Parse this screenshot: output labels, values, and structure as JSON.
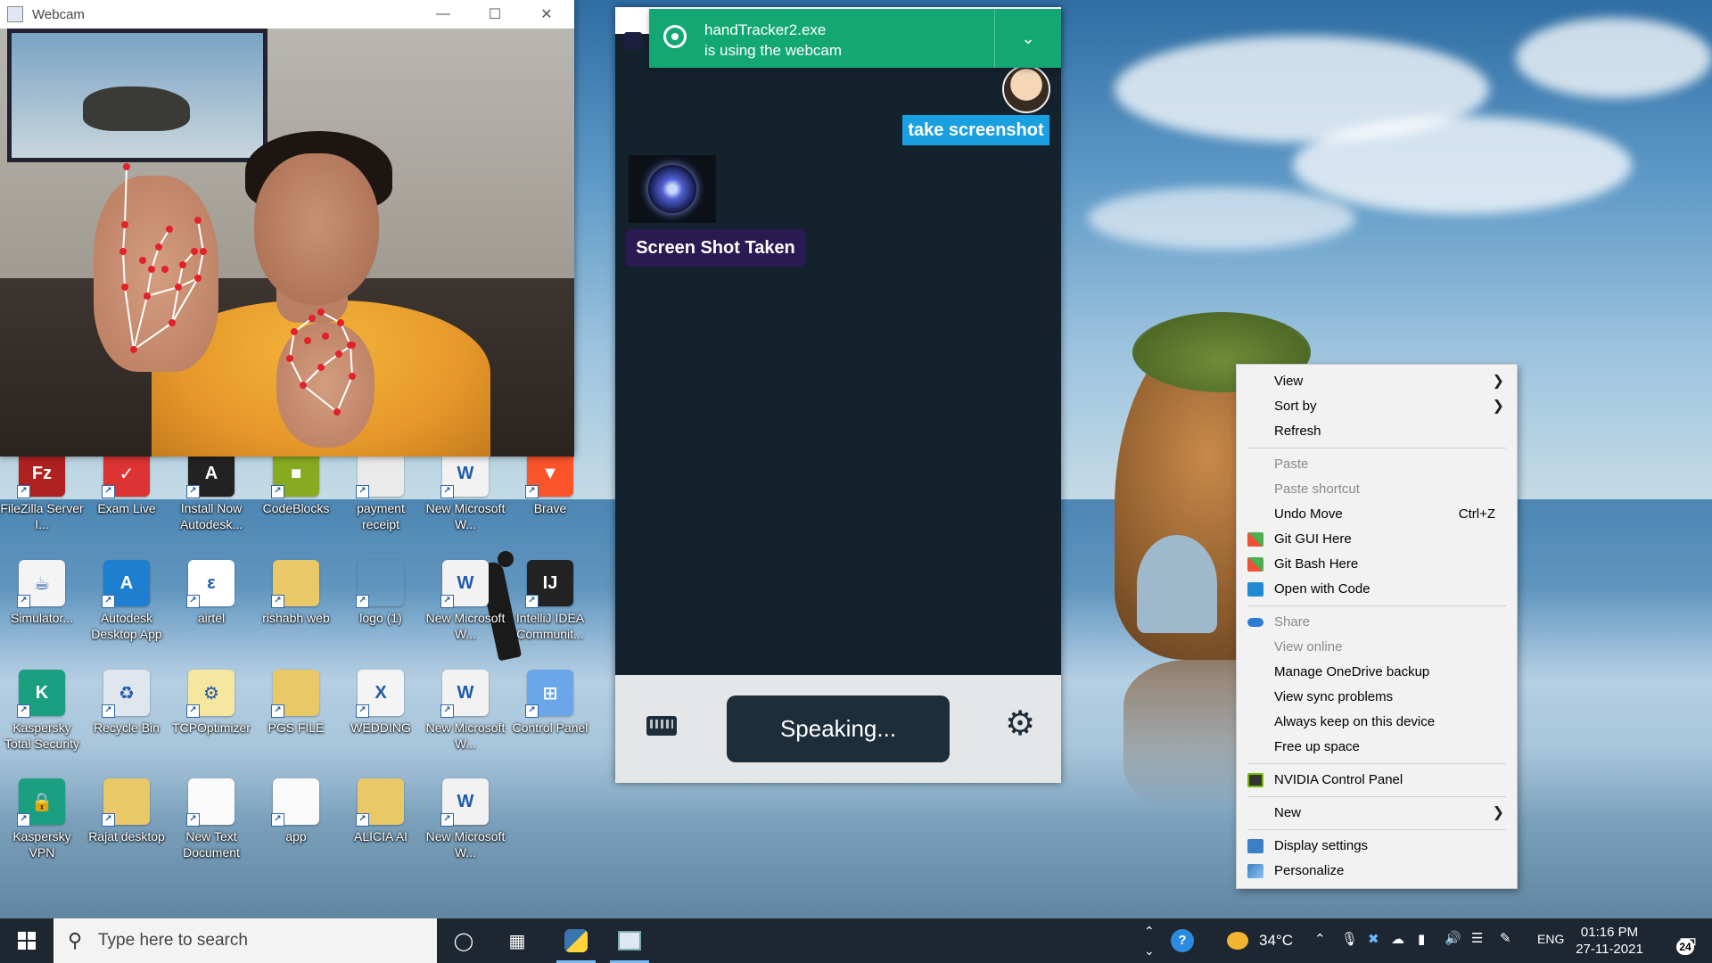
{
  "webcam_window": {
    "title": "Webcam"
  },
  "toast": {
    "line1": "handTracker2.exe",
    "line2": "is using the webcam"
  },
  "assistant": {
    "user_message": "take screenshot",
    "bot_message": "Screen Shot Taken",
    "speak_button": "Speaking..."
  },
  "desktop_icons": [
    {
      "label": "FileZilla Server I...",
      "color": "#b02020",
      "glyph": "Fz"
    },
    {
      "label": "Exam Live",
      "color": "#d33",
      "glyph": "✓"
    },
    {
      "label": "Install Now Autodesk...",
      "color": "#222",
      "glyph": "A"
    },
    {
      "label": "CodeBlocks",
      "color": "#8a2",
      "glyph": "■"
    },
    {
      "label": "payment receipt",
      "color": "#eaeaea",
      "glyph": ""
    },
    {
      "label": "New Microsoft W...",
      "color": "#f2f2f2",
      "glyph": "W"
    },
    {
      "label": "Brave",
      "color": "#fb542b",
      "glyph": "▼"
    },
    {
      "label": "Simulator...",
      "color": "#f4f4f4",
      "glyph": "☕"
    },
    {
      "label": "Autodesk Desktop App",
      "color": "#1e7fd0",
      "glyph": "A"
    },
    {
      "label": "airtel",
      "color": "#fff",
      "glyph": "ε"
    },
    {
      "label": "rishabh web",
      "color": "#e9c868",
      "glyph": ""
    },
    {
      "label": "logo (1)",
      "color": "rgba(0,0,0,0)",
      "glyph": ""
    },
    {
      "label": "New Microsoft W...",
      "color": "#f2f2f2",
      "glyph": "W"
    },
    {
      "label": "IntelliJ IDEA Communit...",
      "color": "#222",
      "glyph": "IJ"
    },
    {
      "label": "Kaspersky Total Security",
      "color": "#1aa080",
      "glyph": "K"
    },
    {
      "label": "Recycle Bin",
      "color": "#dfe6ee",
      "glyph": "♻"
    },
    {
      "label": "TCPOptimizer",
      "color": "#f5e6a0",
      "glyph": "⚙"
    },
    {
      "label": "PGS FILE",
      "color": "#e9c868",
      "glyph": ""
    },
    {
      "label": "WEDDING",
      "color": "#f4f4f4",
      "glyph": "X"
    },
    {
      "label": "New Microsoft W...",
      "color": "#f2f2f2",
      "glyph": "W"
    },
    {
      "label": "Control Panel",
      "color": "#6aa6e8",
      "glyph": "⊞"
    },
    {
      "label": "Kaspersky VPN",
      "color": "#1aa080",
      "glyph": "🔒"
    },
    {
      "label": "Rajat desktop",
      "color": "#e9c868",
      "glyph": ""
    },
    {
      "label": "New Text Document",
      "color": "#fafafa",
      "glyph": ""
    },
    {
      "label": "app",
      "color": "#fafafa",
      "glyph": ""
    },
    {
      "label": "ALICIA AI",
      "color": "#e9c868",
      "glyph": ""
    },
    {
      "label": "New Microsoft W...",
      "color": "#f2f2f2",
      "glyph": "W"
    }
  ],
  "context_menu": {
    "view": "View",
    "sort_by": "Sort by",
    "refresh": "Refresh",
    "paste": "Paste",
    "paste_shortcut": "Paste shortcut",
    "undo_move": "Undo Move",
    "undo_shortcut": "Ctrl+Z",
    "git_gui": "Git GUI Here",
    "git_bash": "Git Bash Here",
    "open_with_code": "Open with Code",
    "share": "Share",
    "view_online": "View online",
    "manage_backup": "Manage OneDrive backup",
    "view_sync": "View sync problems",
    "always_keep": "Always keep on this device",
    "free_space": "Free up space",
    "nvidia": "NVIDIA Control Panel",
    "new": "New",
    "display_settings": "Display settings",
    "personalize": "Personalize"
  },
  "taskbar": {
    "search_placeholder": "Type here to search",
    "temperature": "34°C",
    "language": "ENG",
    "time": "01:16 PM",
    "date": "27-11-2021",
    "notification_count": "24"
  }
}
